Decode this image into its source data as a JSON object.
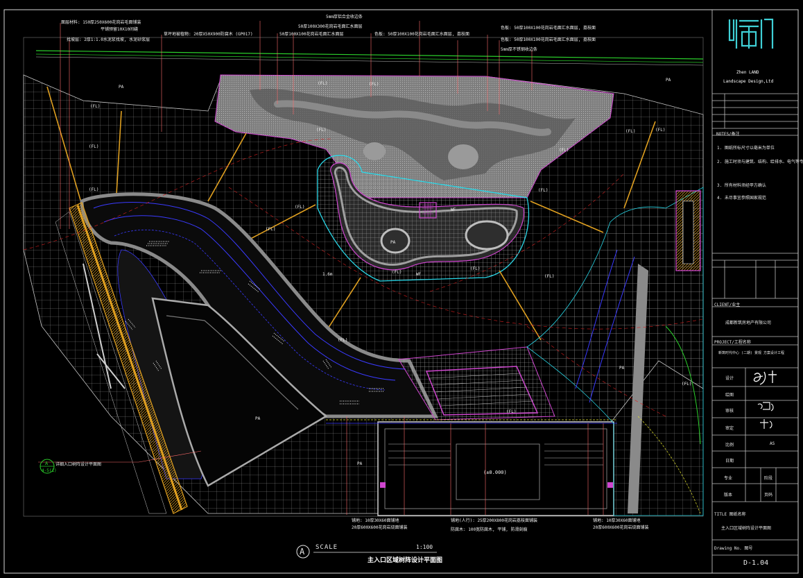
{
  "logo": {
    "line1": "Zhen LAND",
    "line2": "Landscape Design,Ltd"
  },
  "plan": {
    "scale_label": "SCALE",
    "scale_value": "1:100",
    "title": "主入口区域树阵设计平面图",
    "section_tag": "A",
    "callout_tag": "A",
    "callout_ref": "4-5(1)",
    "callout_text": "详细入口树阵设计平面图",
    "elevation": "(±0.000)",
    "fl_label": "(FL)",
    "pa_label": "PA",
    "wf_label": "WF",
    "lower_label": "1.6m",
    "notes_top": [
      "面层材料: 150厚250X600花岗岩毛面铺装",
      "平铺预留10X10间缝",
      "找坡层: 2厚1:1.0水泥浆找坡, 水泥砂浆层",
      "草坪地被植物: 20厚X50X900防腐木 (GP017)",
      "5mm厚铝合金收边条",
      "50厚100X300花岗岩毛面汇水面层",
      "50厚100X100花岗岩毛面汇水面层",
      "色板: 50厚100X100花岗岩毛面汇水面层, 荔枝面",
      "色板: 50厚100X100花岗岩毛面汇水面层, 荔枝面",
      "色板: 50厚100X100花岗岩毛面汇水面层, 荔枝面",
      "5mm厚不锈钢收边条"
    ],
    "notes_bottom": [
      "20厚600X600花岗岩烧面铺装",
      "铺地(人行): 25厚200X800花岗岩荔枝面铺装",
      "防腐木: 100宽防腐木, 平铺, 防滑刻痕",
      "20厚600X600花岗岩烧面铺装",
      "铺地: 10厚30X60面铺地",
      "铺地: 10厚30X60面铺地"
    ]
  },
  "titleblock": {
    "notes_label": "NOTES/备注",
    "notes": [
      "1. 图纸所标尺寸以毫米为单位",
      "2. 施工时须与建筑、结构、给排水、电气等专业图纸配合施工",
      "3. 所有材料须经甲方确认",
      "4. 未尽事宜参照国家规范"
    ],
    "client_label": "CLIENT/业主",
    "client": "成都新筑房地产有限公司",
    "project_label": "PROJECT/工程名称",
    "project": "新筑时代中心 (二期) 景观 方案设计工程",
    "rows": [
      {
        "label": "设计",
        "value": ""
      },
      {
        "label": "绘图",
        "value": ""
      },
      {
        "label": "审核",
        "value": ""
      },
      {
        "label": "审定",
        "value": ""
      },
      {
        "label": "比例",
        "value": "AS"
      },
      {
        "label": "日期",
        "value": ""
      }
    ],
    "extra": [
      {
        "l1": "专业",
        "v1": "",
        "l2": "阶段",
        "v2": ""
      },
      {
        "l1": "版本",
        "v1": "",
        "l2": "页码",
        "v2": ""
      }
    ],
    "title_label": "TITLE 图纸名称",
    "title": "主入口区域树阵设计平面图",
    "drawing_label": "Drawing No. 图号",
    "drawing_no": "D-1.04"
  }
}
